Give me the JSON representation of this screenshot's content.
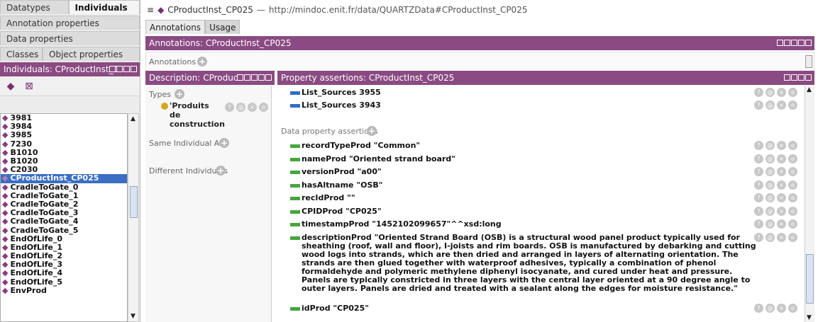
{
  "left_tabs_row1": [
    "Datatypes",
    "Individuals"
  ],
  "left_tabs_row2": [
    "Annotation properties"
  ],
  "left_tabs_row3": [
    "Data properties"
  ],
  "left_tabs_row4": [
    "Classes",
    "Object properties"
  ],
  "individuals_panel_title": "Individuals: CProductInst_C",
  "individuals": [
    "3981",
    "3984",
    "3985",
    "7230",
    "B1010",
    "B1020",
    "C2030",
    "CProductInst_CP025",
    "CradleToGate_0",
    "CradleToGate_1",
    "CradleToGate_2",
    "CradleToGate_3",
    "CradleToGate_4",
    "CradleToGate_5",
    "EndOfLife_0",
    "EndOfLife_1",
    "EndOfLife_2",
    "EndOfLife_3",
    "EndOfLife_4",
    "EndOfLife_5",
    "EnvProd"
  ],
  "selected_individual": "CProductInst_CP025",
  "header": {
    "entity": "CProductInst_CP025",
    "separator": "—",
    "url": "http://mindoc.enit.fr/data/QUARTZData#CProductInst_CP025"
  },
  "content_tabs": [
    "Annotations",
    "Usage"
  ],
  "annotations_title": "Annotations: CProductInst_CP025",
  "annotations_label": "Annotations",
  "description_title": "Description: CProduct",
  "types_label": "Types",
  "type_value": "'Produits de construction",
  "same_individual_label": "Same Individual As",
  "different_individuals_label": "Different Individuals",
  "property_title": "Property assertions: CProductInst_CP025",
  "object_assertions": [
    {
      "prop": "List_Sources",
      "value": "3955"
    },
    {
      "prop": "List_Sources",
      "value": "3943"
    }
  ],
  "data_assertions_label": "Data property assertions",
  "data_assertions": [
    {
      "prop": "recordTypeProd",
      "value": "\"Common\""
    },
    {
      "prop": "nameProd",
      "value": "\"Oriented strand board\""
    },
    {
      "prop": "versionProd",
      "value": "\"a00\""
    },
    {
      "prop": "hasAltname",
      "value": "\"OSB\""
    },
    {
      "prop": "recIdProd",
      "value": "\"\""
    },
    {
      "prop": "CPIDProd",
      "value": "\"CP025\""
    },
    {
      "prop": "timestampProd",
      "value": "\"1452102099657\"^^xsd:long"
    },
    {
      "prop": "descriptionProd",
      "value": "\"Oriented Strand Board (OSB) is a structural wood panel product typically used for sheathing (roof, wall and floor), I-joists and rim boards. OSB is manufactured by debarking and cutting wood logs into strands, which are then dried and arranged in layers of alternating orientation. The strands are then glued together with waterproof adhesives, typically a combination of phenol formaldehyde and polymeric methylene diphenyl isocyanate, and cured under heat and pressure. Panels are typically constricted in three layers with the central layer oriented at a 90 degree angle to outer layers. Panels are dried and treated with a sealant along the edges for moisture resistance.\""
    },
    {
      "prop": "idProd",
      "value": "\"CP025\""
    }
  ],
  "colors": {
    "accent": "#8a4a82",
    "selection": "#3a6fc4",
    "object_prop": "#2e6fc9",
    "data_prop": "#45a63d"
  }
}
